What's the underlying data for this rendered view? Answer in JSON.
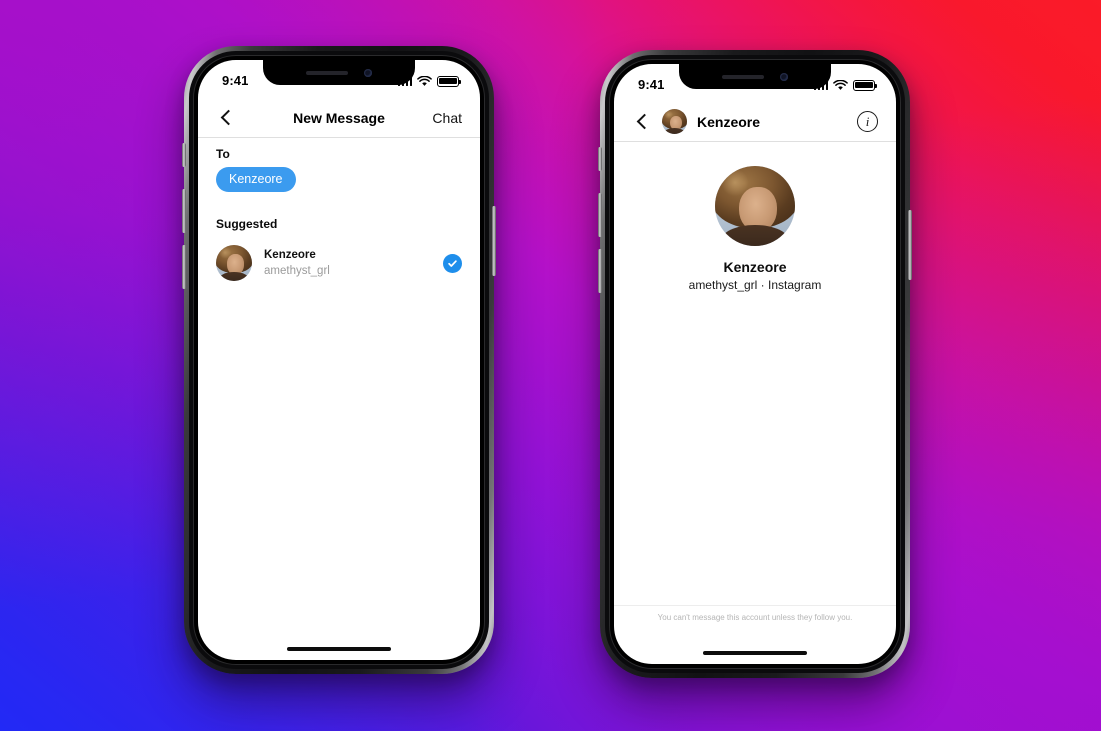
{
  "background": {
    "gradient_colors": [
      "#2129F5",
      "#9012D6",
      "#C511B4",
      "#F8182F"
    ],
    "description": "diagonal blue-to-purple-to-red gradient"
  },
  "theme": {
    "accent_blue": "#3897F0",
    "chip_blue": "#3B9BEF",
    "check_blue": "#1E8EEB",
    "text_primary": "#111111",
    "text_muted": "#9B9B9B",
    "footer_text": "#B5B5B5"
  },
  "phone_left": {
    "status_bar": {
      "time": "9:41",
      "signal_icon": "cellular-bars-icon",
      "wifi_icon": "wifi-icon",
      "battery_icon": "battery-full-icon"
    },
    "navbar": {
      "back_icon": "chevron-left-icon",
      "title": "New Message",
      "action_label": "Chat"
    },
    "to_section": {
      "label": "To",
      "chips": [
        {
          "label": "Kenzeore"
        }
      ]
    },
    "suggested_section": {
      "label": "Suggested",
      "rows": [
        {
          "name": "Kenzeore",
          "username": "amethyst_grl",
          "avatar_icon": "user-avatar-photo",
          "selected": true,
          "check_icon": "check-circle-filled-icon"
        }
      ]
    },
    "home_indicator": "home-indicator"
  },
  "phone_right": {
    "status_bar": {
      "time": "9:41",
      "signal_icon": "cellular-bars-icon",
      "wifi_icon": "wifi-icon",
      "battery_icon": "battery-full-icon"
    },
    "navbar": {
      "back_icon": "chevron-left-icon",
      "avatar_icon": "user-avatar-photo",
      "title": "Kenzeore",
      "info_icon": "info-circle-icon",
      "info_glyph": "i"
    },
    "profile": {
      "avatar_icon": "user-avatar-photo",
      "name": "Kenzeore",
      "meta": "amethyst_grl · Instagram"
    },
    "footer_note": "You can't message this account unless they follow you.",
    "home_indicator": "home-indicator"
  }
}
